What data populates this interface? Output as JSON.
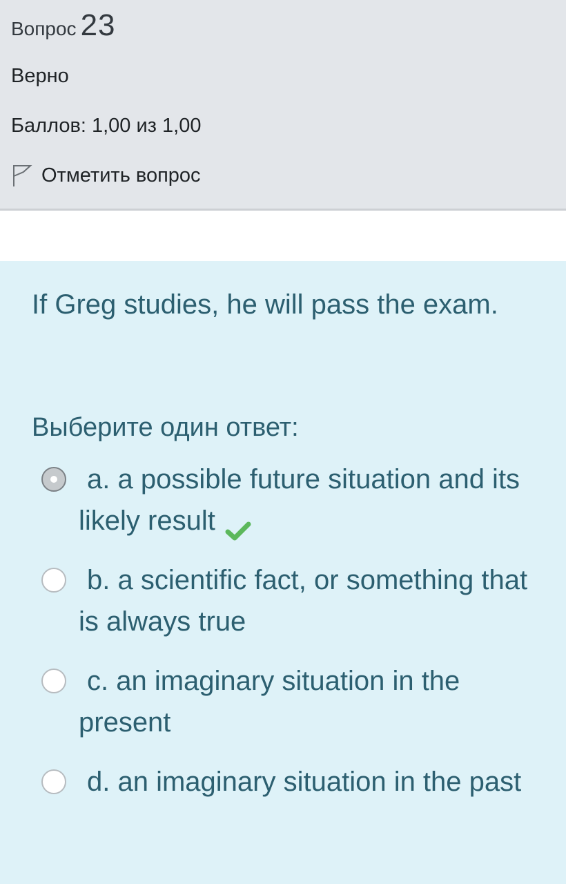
{
  "info": {
    "question_word": "Вопрос",
    "question_number": "23",
    "state": "Верно",
    "grade": "Баллов: 1,00 из 1,00",
    "flag_label": "Отметить вопрос",
    "flag_icon": "flag-outline-icon"
  },
  "question": {
    "text": "If Greg studies, he will pass the exam.",
    "prompt": "Выберите один ответ:",
    "answers": [
      {
        "label": "a. a possible future situation and its likely result",
        "selected": true,
        "correct": true
      },
      {
        "label": "b. a scientific fact, or something that is always true",
        "selected": false,
        "correct": false
      },
      {
        "label": "c. an imaginary situation in the present",
        "selected": false,
        "correct": false
      },
      {
        "label": "d. an imaginary situation in the past",
        "selected": false,
        "correct": false
      }
    ],
    "correct_icon": "checkmark-icon"
  },
  "colors": {
    "info_bg": "#e3e6ea",
    "question_bg": "#def2f8",
    "question_text": "#2c5f70",
    "correct_check": "#5cb85c"
  }
}
